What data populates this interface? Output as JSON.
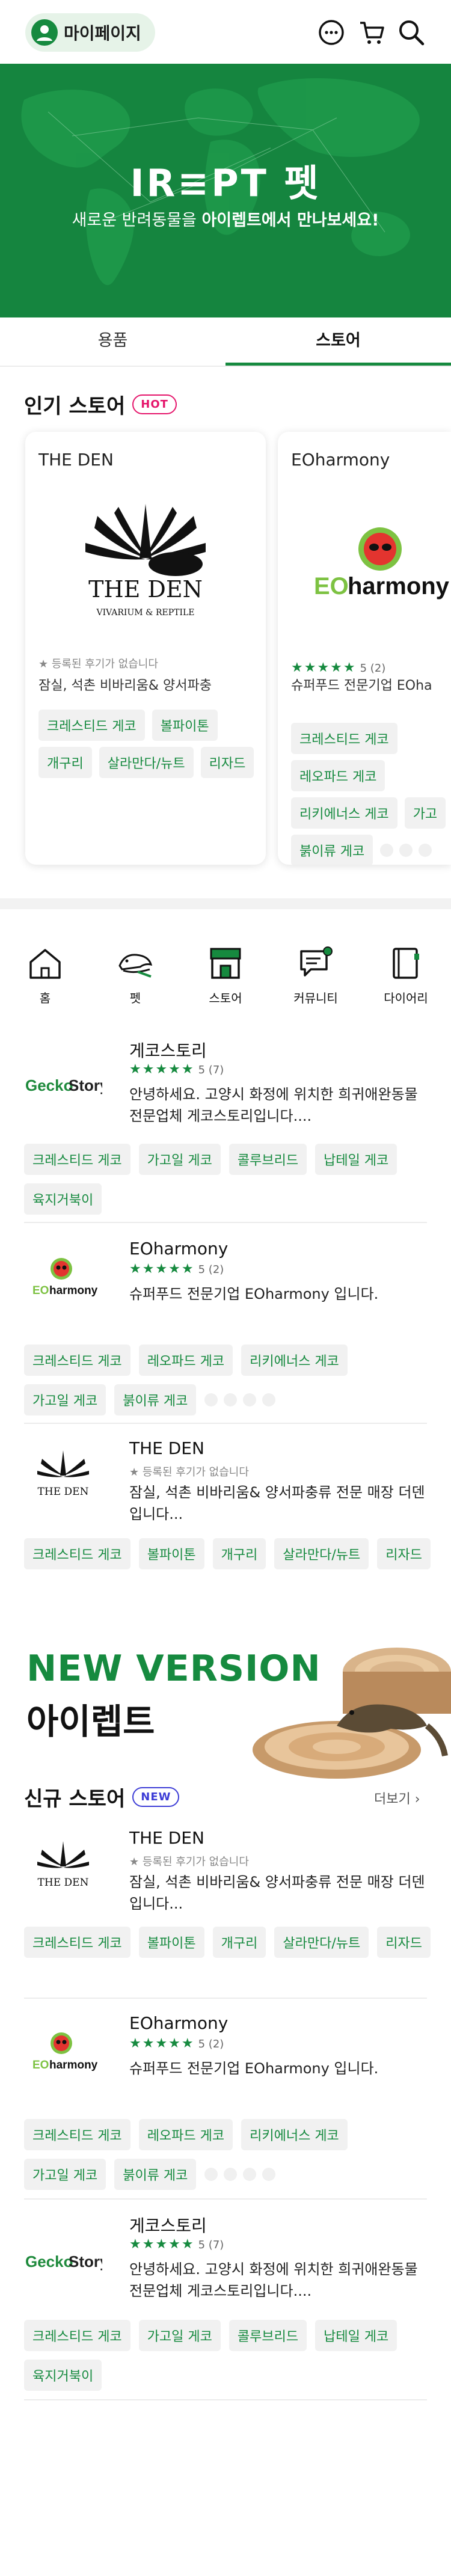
{
  "header": {
    "mypage_label": "마이페이지",
    "icons": [
      "user-icon",
      "chat-icon",
      "cart-icon",
      "search-icon"
    ]
  },
  "banner": {
    "logo": "IR≡PT 펫",
    "sub_prefix": "새로운 반려동물을 ",
    "sub_bold": "아이렙트에서 만나보세요!"
  },
  "tabs": [
    {
      "label": "용품"
    },
    {
      "label": "스토어"
    }
  ],
  "popular": {
    "title": "인기 스토어",
    "badge": "HOT",
    "cards": [
      {
        "name": "THE DEN",
        "rating_text": "★ 등록된 후기가 없습니다",
        "desc": "잠실, 석촌 비바리움& 양서파충",
        "tags": [
          "크레스티드 게코",
          "볼파이톤",
          "개구리",
          "살라만다/뉴트",
          "리자드"
        ]
      },
      {
        "name": "EOharmony",
        "stars": "★★★★★",
        "count": "5 (2)",
        "desc": "슈퍼푸드 전문기업 EOha",
        "tags": [
          "크레스티드 게코",
          "레오파드 게코",
          "리키에너스 게코",
          "가고",
          "붉이류 게코"
        ]
      }
    ]
  },
  "categories": [
    {
      "label": "홈",
      "icon": "home-icon"
    },
    {
      "label": "펫",
      "icon": "pet-icon"
    },
    {
      "label": "스토어",
      "icon": "store-icon"
    },
    {
      "label": "커뮤니티",
      "icon": "community-icon"
    },
    {
      "label": "다이어리",
      "icon": "diary-icon"
    }
  ],
  "stores": [
    {
      "name": "게코스토리",
      "logo": "GeckoStory",
      "stars": "★★★★★",
      "count": "5 (7)",
      "desc": "안녕하세요. 고양시 화정에 위치한 희귀애완동물 전문업체 게코스토리입니다....",
      "tags": [
        "크레스티드 게코",
        "가고일 게코",
        "콜루브리드",
        "납테일 게코",
        "육지거북이"
      ]
    },
    {
      "name": "EOharmony",
      "logo": "EOharmony",
      "stars": "★★★★★",
      "count": "5 (2)",
      "desc": "슈퍼푸드 전문기업 EOharmony 입니다.",
      "tags": [
        "크레스티드 게코",
        "레오파드 게코",
        "리키에너스 게코",
        "가고일 게코",
        "붉이류 게코"
      ]
    },
    {
      "name": "THE DEN",
      "logo": "THE DEN",
      "rating_text": "★ 등록된 후기가 없습니다",
      "desc": "잠실, 석촌 비바리움& 양서파충류 전문 매장 더덴입니다...",
      "tags": [
        "크레스티드 게코",
        "볼파이톤",
        "개구리",
        "살라만다/뉴트",
        "리자드"
      ]
    }
  ],
  "new_version": {
    "title": "NEW VERSION",
    "subtitle": "아이렙트"
  },
  "new_stores": {
    "title": "신규 스토어",
    "badge": "NEW",
    "more": "더보기 ›",
    "items": [
      {
        "name": "THE DEN",
        "logo": "THE DEN",
        "rating_text": "★ 등록된 후기가 없습니다",
        "desc": "잠실, 석촌 비바리움& 양서파충류 전문 매장 더덴입니다...",
        "tags": [
          "크레스티드 게코",
          "볼파이톤",
          "개구리",
          "살라만다/뉴트",
          "리자드"
        ]
      },
      {
        "name": "EOharmony",
        "logo": "EOharmony",
        "stars": "★★★★★",
        "count": "5 (2)",
        "desc": "슈퍼푸드 전문기업 EOharmony 입니다.",
        "tags": [
          "크레스티드 게코",
          "레오파드 게코",
          "리키에너스 게코",
          "가고일 게코",
          "붉이류 게코"
        ]
      },
      {
        "name": "게코스토리",
        "logo": "GeckoStory",
        "stars": "★★★★★",
        "count": "5 (7)",
        "desc": "안녕하세요. 고양시 화정에 위치한 희귀애완동물 전문업체 게코스토리입니다....",
        "tags": [
          "크레스티드 게코",
          "가고일 게코",
          "콜루브리드",
          "납테일 게코",
          "육지거북이"
        ]
      }
    ]
  },
  "colors": {
    "brand": "#168a3f",
    "hot": "#e5156b",
    "new": "#3d3dd6"
  }
}
